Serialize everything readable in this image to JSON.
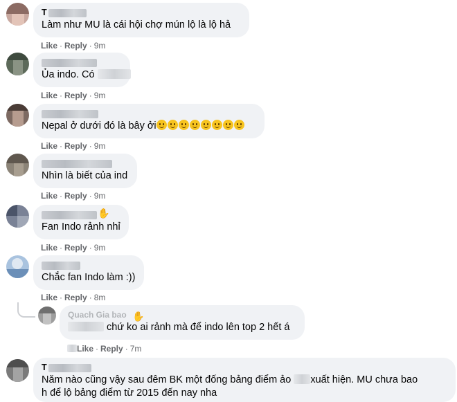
{
  "comments": [
    {
      "name_prefix": "T",
      "text": "Làm như MU là cái hội chợ mún lộ là lộ hả",
      "like": "Like",
      "reply": "Reply",
      "time": "9m"
    },
    {
      "name_prefix": "",
      "text_before": "Ủa indo. Có ",
      "like": "Like",
      "reply": "Reply",
      "time": "9m"
    },
    {
      "name_prefix": "",
      "text": "Nepal ở dưới đó là bây ởi",
      "emoji_count": 8,
      "like": "Like",
      "reply": "Reply",
      "time": "9m"
    },
    {
      "name_prefix": "",
      "text": "Nhìn là biết của ind",
      "like": "Like",
      "reply": "Reply",
      "time": "9m"
    },
    {
      "name_prefix": "",
      "text": "Fan Indo rảnh nhỉ",
      "like": "Like",
      "reply": "Reply",
      "time": "9m",
      "icon": "wave-hand-icon"
    },
    {
      "name_prefix": "",
      "text": "Chắc fan Indo làm :))",
      "like": "Like",
      "reply": "Reply",
      "time": "8m"
    },
    {
      "name": "Quach Gia bao",
      "text": "chứ ko ai rảnh mà để indo lên top 2 hết á",
      "like": "Like",
      "reply": "Reply",
      "time": "7m",
      "icon": "wave-hand-icon"
    },
    {
      "name_prefix": "T",
      "text_line1": "Năm nào cũng vậy sau đêm BK một đống bảng điểm ảo",
      "text_line1b": "xuất hiện. MU chưa bao",
      "text_line2": "h để lộ bảng điểm từ 2015 đến nay nha"
    }
  ],
  "colors": {
    "bubble": "#f0f2f5",
    "action": "#65676b",
    "text": "#050505"
  }
}
